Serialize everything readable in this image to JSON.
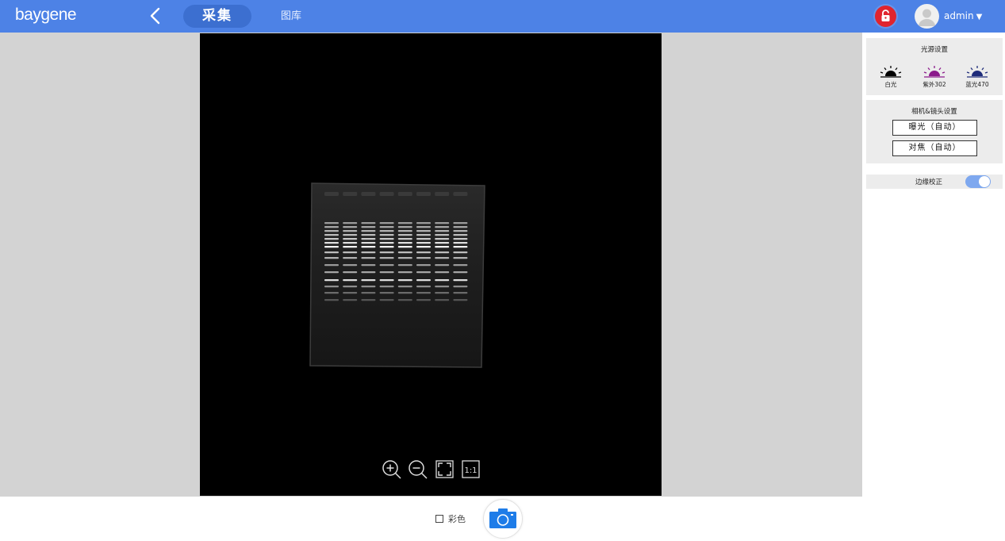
{
  "header": {
    "logo": "baygene",
    "tabs": [
      "采集",
      "图库"
    ],
    "user": "admin",
    "icons": [
      "back-icon",
      "lock-icon",
      "avatar-icon",
      "caret-down-icon"
    ]
  },
  "viewer": {
    "tools": [
      "zoom-in-icon",
      "zoom-out-icon",
      "fit-screen-icon",
      "actual-size-icon"
    ],
    "actual_size_label": "1:1"
  },
  "panel": {
    "light": {
      "title": "光源设置",
      "sources": [
        {
          "label": "白光",
          "color": "#000000"
        },
        {
          "label": "紫外302",
          "color": "#8b1a8b"
        },
        {
          "label": "蓝光470",
          "color": "#1f2c7a"
        }
      ]
    },
    "camera": {
      "title": "相机&镜头设置",
      "exposure": "曝光（自动）",
      "focus": "对焦（自动）"
    },
    "edge_correction": {
      "label": "边缘校正",
      "enabled": true
    }
  },
  "bottom": {
    "color_label": "彩色",
    "color_checked": false
  },
  "colors": {
    "accent": "#4d82e6",
    "lock": "#e0242f",
    "shutter": "#1e7ce8"
  }
}
